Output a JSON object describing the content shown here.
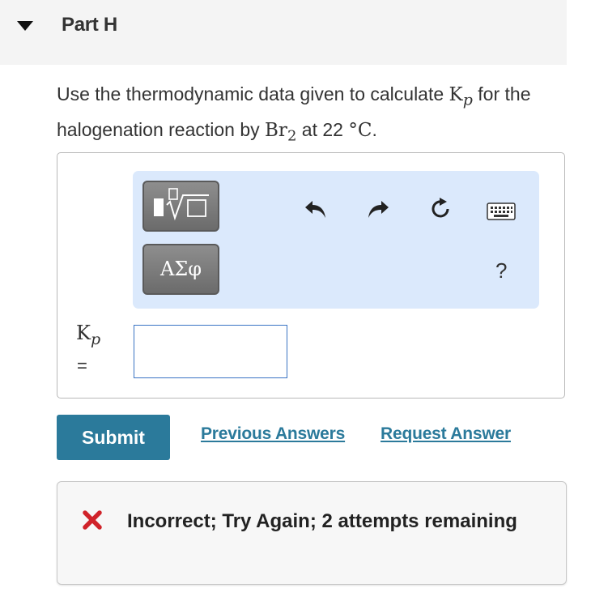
{
  "part": {
    "title": "Part H"
  },
  "question": {
    "text_before": "Use the thermodynamic data given to calculate ",
    "k_symbol": "K",
    "k_subscript": "p",
    "text_middle": " for the halogenation reaction by ",
    "molecule": "Br",
    "molecule_subscript": "2",
    "text_after": " at 22 ",
    "temperature_unit": "°C",
    "period": "."
  },
  "toolbar": {
    "symbols_label": "ΑΣφ",
    "help_label": "?",
    "icons": [
      "templates-icon",
      "undo-icon",
      "redo-icon",
      "reset-icon",
      "keyboard-icon"
    ]
  },
  "answer": {
    "label_symbol": "K",
    "label_subscript": "p",
    "equals": "=",
    "value": ""
  },
  "actions": {
    "submit_label": "Submit",
    "previous_answers_label": "Previous Answers",
    "request_answer_label": "Request Answer"
  },
  "feedback": {
    "message": "Incorrect; Try Again; 2 attempts remaining",
    "status_color": "#d0232a"
  },
  "colors": {
    "accent": "#2b7a9b",
    "toolbar_bg": "#dbe9fc",
    "input_border": "#3a74c4"
  }
}
